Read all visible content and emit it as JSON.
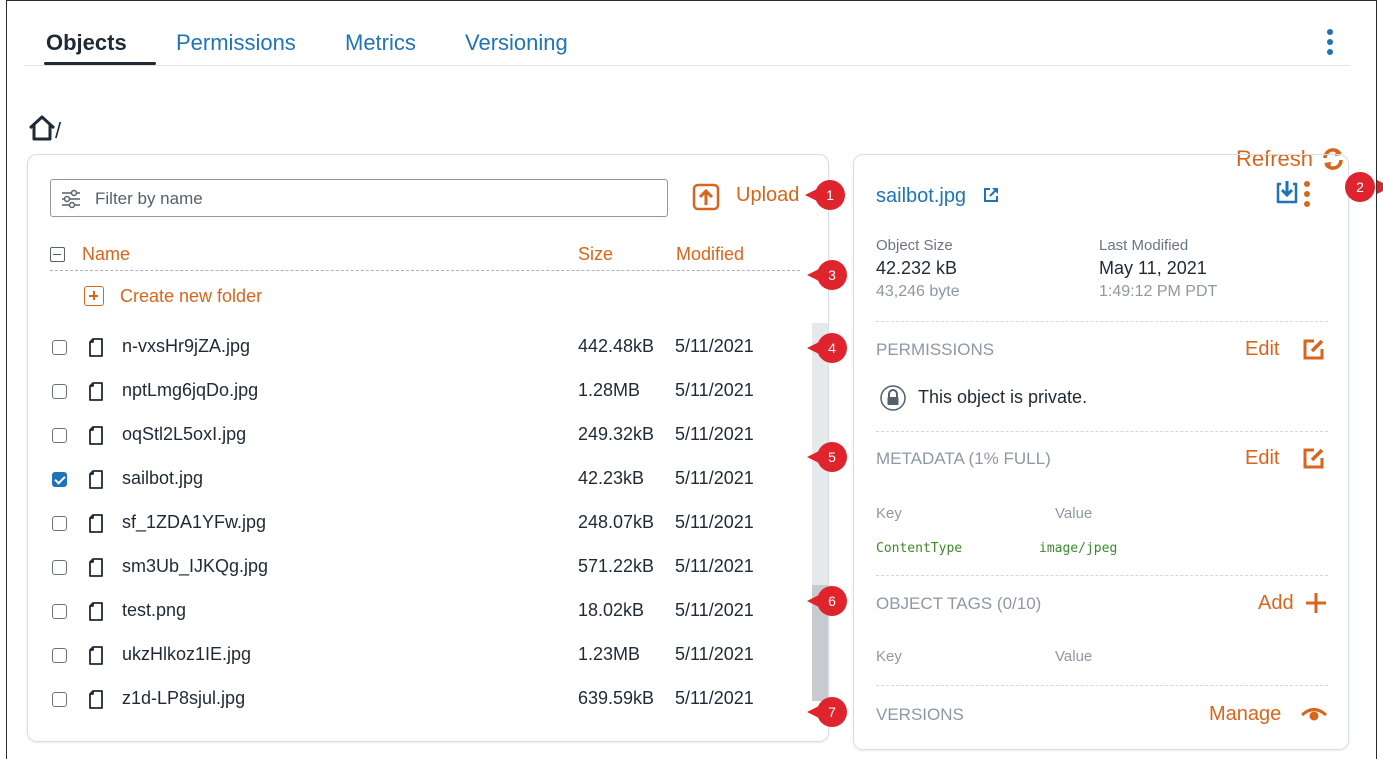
{
  "tabs": [
    {
      "label": "Objects"
    },
    {
      "label": "Permissions"
    },
    {
      "label": "Metrics"
    },
    {
      "label": "Versioning"
    }
  ],
  "breadcrumb": {
    "separator": "/"
  },
  "refresh_label": "Refresh",
  "browser": {
    "filter_placeholder": "Filter by name",
    "upload_label": "Upload",
    "columns": {
      "name": "Name",
      "size": "Size",
      "modified": "Modified"
    },
    "create_folder_label": "Create new folder",
    "files": [
      {
        "name": "n-vxsHr9jZA.jpg",
        "size": "442.48kB",
        "modified": "5/11/2021",
        "checked": false
      },
      {
        "name": "nptLmg6jqDo.jpg",
        "size": "1.28MB",
        "modified": "5/11/2021",
        "checked": false
      },
      {
        "name": "oqStl2L5oxI.jpg",
        "size": "249.32kB",
        "modified": "5/11/2021",
        "checked": false
      },
      {
        "name": "sailbot.jpg",
        "size": "42.23kB",
        "modified": "5/11/2021",
        "checked": true
      },
      {
        "name": "sf_1ZDA1YFw.jpg",
        "size": "248.07kB",
        "modified": "5/11/2021",
        "checked": false
      },
      {
        "name": "sm3Ub_IJKQg.jpg",
        "size": "571.22kB",
        "modified": "5/11/2021",
        "checked": false
      },
      {
        "name": "test.png",
        "size": "18.02kB",
        "modified": "5/11/2021",
        "checked": false
      },
      {
        "name": "ukzHlkoz1IE.jpg",
        "size": "1.23MB",
        "modified": "5/11/2021",
        "checked": false
      },
      {
        "name": "z1d-LP8sjul.jpg",
        "size": "639.59kB",
        "modified": "5/11/2021",
        "checked": false
      }
    ]
  },
  "details": {
    "object_name": "sailbot.jpg",
    "object_size_label": "Object Size",
    "object_size": "42.232 kB",
    "object_size_bytes": "43,246 byte",
    "last_modified_label": "Last Modified",
    "last_modified_date": "May 11, 2021",
    "last_modified_time": "1:49:12 PM PDT",
    "permissions_title": "PERMISSIONS",
    "permissions_edit": "Edit",
    "private_text": "This object is private.",
    "metadata_title": "METADATA (1% FULL)",
    "metadata_edit": "Edit",
    "key_label": "Key",
    "value_label": "Value",
    "metadata_key": "ContentType",
    "metadata_value": "image/jpeg",
    "tags_title": "OBJECT TAGS (0/10)",
    "tags_add": "Add",
    "tags_key_label": "Key",
    "tags_value_label": "Value",
    "versions_title": "VERSIONS",
    "versions_manage": "Manage"
  },
  "callouts": [
    "1",
    "2",
    "3",
    "4",
    "5",
    "6",
    "7"
  ],
  "colors": {
    "accent": "#d9651c",
    "link": "#1f73b7",
    "callout": "#e0242d",
    "text": "#1f2a36"
  }
}
